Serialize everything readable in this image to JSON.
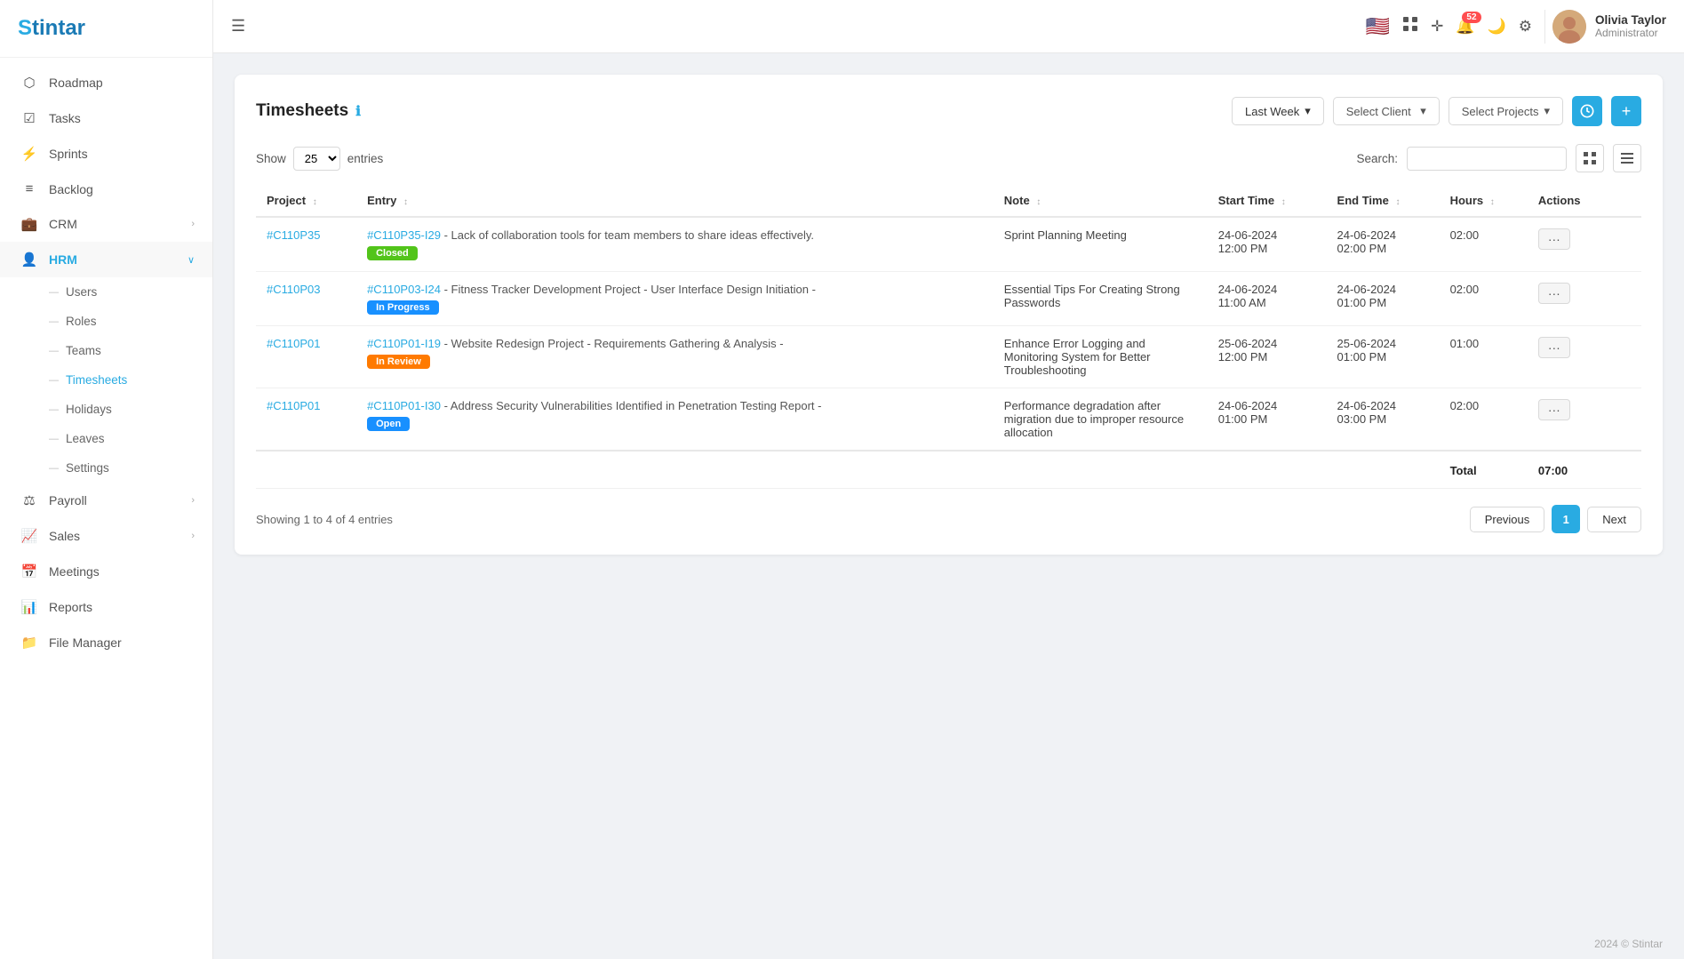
{
  "sidebar": {
    "logo": "Stintar",
    "items": [
      {
        "id": "roadmap",
        "label": "Roadmap",
        "icon": "📊",
        "hasArrow": false
      },
      {
        "id": "tasks",
        "label": "Tasks",
        "icon": "☑",
        "hasArrow": false
      },
      {
        "id": "sprints",
        "label": "Sprints",
        "icon": "⚡",
        "hasArrow": false
      },
      {
        "id": "backlog",
        "label": "Backlog",
        "icon": "📋",
        "hasArrow": false
      },
      {
        "id": "crm",
        "label": "CRM",
        "icon": "💼",
        "hasArrow": true
      },
      {
        "id": "hrm",
        "label": "HRM",
        "icon": "👥",
        "hasArrow": true,
        "expanded": true
      },
      {
        "id": "payroll",
        "label": "Payroll",
        "icon": "💰",
        "hasArrow": true
      },
      {
        "id": "sales",
        "label": "Sales",
        "icon": "📈",
        "hasArrow": true
      },
      {
        "id": "meetings",
        "label": "Meetings",
        "icon": "📅",
        "hasArrow": false
      },
      {
        "id": "reports",
        "label": "Reports",
        "icon": "📊",
        "hasArrow": false
      },
      {
        "id": "file-manager",
        "label": "File Manager",
        "icon": "📁",
        "hasArrow": false
      }
    ],
    "hrm_sub_items": [
      {
        "id": "users",
        "label": "Users"
      },
      {
        "id": "roles",
        "label": "Roles"
      },
      {
        "id": "teams",
        "label": "Teams"
      },
      {
        "id": "timesheets",
        "label": "Timesheets",
        "active": true
      },
      {
        "id": "holidays",
        "label": "Holidays"
      },
      {
        "id": "leaves",
        "label": "Leaves"
      },
      {
        "id": "settings",
        "label": "Settings"
      }
    ]
  },
  "header": {
    "menu_icon": "☰",
    "notification_count": "52",
    "user": {
      "name": "Olivia Taylor",
      "role": "Administrator"
    }
  },
  "timesheets": {
    "title": "Timesheets",
    "filter_week": "Last Week",
    "filter_client": "Select Client",
    "filter_projects": "Select Projects",
    "show_label": "Show",
    "entries_label": "entries",
    "entries_value": "25",
    "search_label": "Search:",
    "search_placeholder": "",
    "showing_text": "Showing 1 to 4 of 4 entries",
    "total_label": "Total",
    "total_hours": "07:00",
    "columns": [
      "Project",
      "Entry",
      "Note",
      "Start Time",
      "End Time",
      "Hours",
      "Actions"
    ],
    "rows": [
      {
        "project": "#C110P35",
        "entry_id": "#C110P35-I29",
        "entry_desc": "Lack of collaboration tools for team members to share ideas effectively.",
        "badge": "Closed",
        "badge_type": "closed",
        "note": "Sprint Planning Meeting",
        "start_time": "24-06-2024\n12:00 PM",
        "end_time": "24-06-2024\n02:00 PM",
        "hours": "02:00"
      },
      {
        "project": "#C110P03",
        "entry_id": "#C110P03-I24",
        "entry_desc": "Fitness Tracker Development Project - User Interface Design Initiation -",
        "badge": "In Progress",
        "badge_type": "inprogress",
        "note": "Essential Tips For Creating Strong Passwords",
        "start_time": "24-06-2024\n11:00 AM",
        "end_time": "24-06-2024\n01:00 PM",
        "hours": "02:00"
      },
      {
        "project": "#C110P01",
        "entry_id": "#C110P01-I19",
        "entry_desc": "Website Redesign Project - Requirements Gathering & Analysis -",
        "badge": "In Review",
        "badge_type": "inreview",
        "note": "Enhance Error Logging and Monitoring System for Better Troubleshooting",
        "start_time": "25-06-2024\n12:00 PM",
        "end_time": "25-06-2024\n01:00 PM",
        "hours": "01:00"
      },
      {
        "project": "#C110P01",
        "entry_id": "#C110P01-I30",
        "entry_desc": "Address Security Vulnerabilities Identified in Penetration Testing Report -",
        "badge": "Open",
        "badge_type": "open",
        "note": "Performance degradation after migration due to improper resource allocation",
        "start_time": "24-06-2024\n01:00 PM",
        "end_time": "24-06-2024\n03:00 PM",
        "hours": "02:00"
      }
    ],
    "pagination": {
      "previous": "Previous",
      "next": "Next",
      "current_page": "1"
    }
  },
  "footer": {
    "copyright": "2024 © Stintar"
  }
}
